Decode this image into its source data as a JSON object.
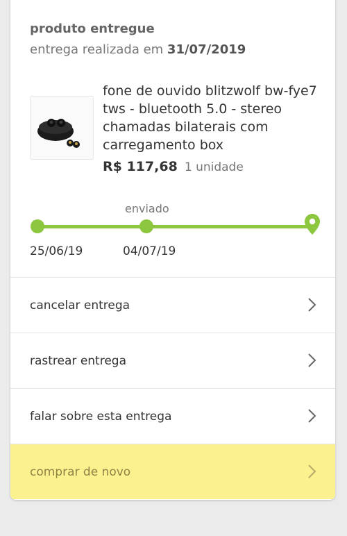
{
  "status": {
    "title": "produto entregue",
    "subtitle_prefix": "entrega realizada em",
    "delivery_date": "31/07/2019"
  },
  "product": {
    "name": "fone de ouvido blitzwolf bw-fye7 tws - bluetooth 5.0 - stereo chamadas bilaterais com carregamento box",
    "price": "R$ 117,68",
    "quantity": "1 unidade"
  },
  "tracking": {
    "step_label": "enviado",
    "dates": [
      "25/06/19",
      "04/07/19"
    ],
    "progress_color": "#8dc63f"
  },
  "actions": [
    {
      "label": "cancelar entrega",
      "icon": "chevron-right-icon"
    },
    {
      "label": "rastrear entrega",
      "icon": "chevron-right-icon"
    },
    {
      "label": "falar sobre esta entrega",
      "icon": "chevron-right-icon"
    },
    {
      "label": "comprar de novo",
      "icon": "chevron-right-icon",
      "highlight_color": "#fbf18f"
    }
  ]
}
